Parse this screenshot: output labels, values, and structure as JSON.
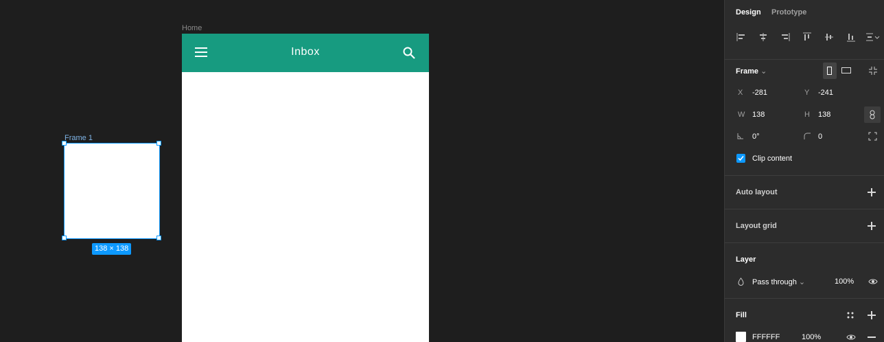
{
  "canvas": {
    "home_label": "Home",
    "frame1_label": "Frame 1",
    "size_badge": "138 × 138",
    "app": {
      "title": "Inbox",
      "bar_color": "#179b80"
    }
  },
  "panel": {
    "tabs": {
      "design": "Design",
      "prototype": "Prototype"
    },
    "frame": {
      "title": "Frame",
      "x_label": "X",
      "x_value": "-281",
      "y_label": "Y",
      "y_value": "-241",
      "w_label": "W",
      "w_value": "138",
      "h_label": "H",
      "h_value": "138",
      "rotation": "0°",
      "radius": "0",
      "clip_label": "Clip content",
      "clip_checked": true
    },
    "auto_layout": "Auto layout",
    "layout_grid": "Layout grid",
    "layer": {
      "title": "Layer",
      "blend": "Pass through",
      "opacity": "100%"
    },
    "fill": {
      "title": "Fill",
      "hex": "FFFFFF",
      "opacity": "100%",
      "color": "#ffffff"
    }
  },
  "colors": {
    "selection": "#0d99ff",
    "accent_check": "#0d99ff"
  }
}
